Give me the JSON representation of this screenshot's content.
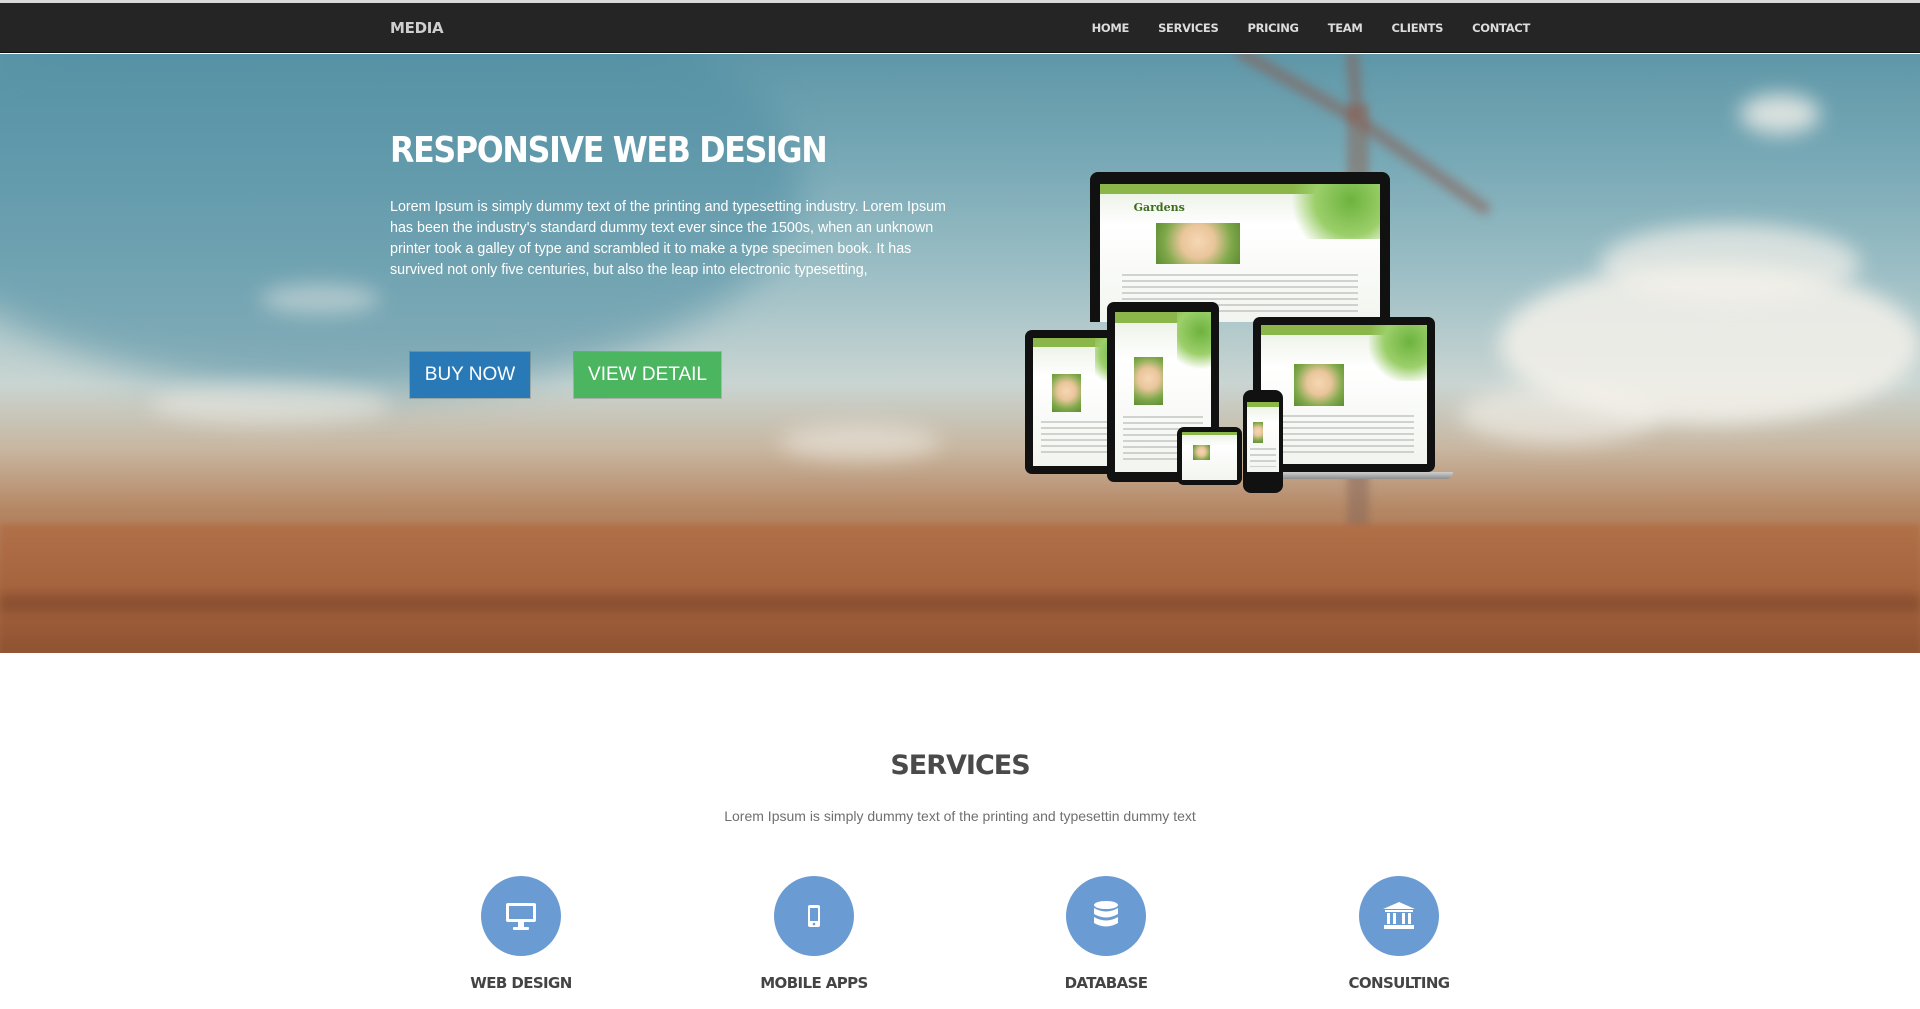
{
  "navbar": {
    "brand": "MEDIA",
    "items": [
      {
        "label": "HOME"
      },
      {
        "label": "SERVICES"
      },
      {
        "label": "PRICING"
      },
      {
        "label": "TEAM"
      },
      {
        "label": "CLIENTS"
      },
      {
        "label": "CONTACT"
      }
    ]
  },
  "hero": {
    "title": "RESPONSIVE WEB DESIGN",
    "text": "Lorem Ipsum is simply dummy text of the printing and typesetting industry. Lorem Ipsum has been the industry's standard dummy text ever since the 1500s, when an unknown printer took a galley of type and scrambled it to make a type specimen book. It has survived not only five centuries, but also the leap into electronic typesetting,",
    "buy_label": "BUY NOW",
    "view_label": "VIEW DETAIL",
    "device_screen_logo": "Gardens"
  },
  "services": {
    "title": "SERVICES",
    "subtitle": "Lorem Ipsum is simply dummy text of the printing and typesettin dummy text",
    "items": [
      {
        "label": "WEB DESIGN",
        "icon": "desktop-icon"
      },
      {
        "label": "MOBILE APPS",
        "icon": "mobile-icon"
      },
      {
        "label": "DATABASE",
        "icon": "database-icon"
      },
      {
        "label": "CONSULTING",
        "icon": "bank-icon"
      }
    ]
  },
  "colors": {
    "navbar": "#252525",
    "buy_button": "#2a79b7",
    "view_button": "#4cb560",
    "service_circle": "#6a9bd3"
  }
}
